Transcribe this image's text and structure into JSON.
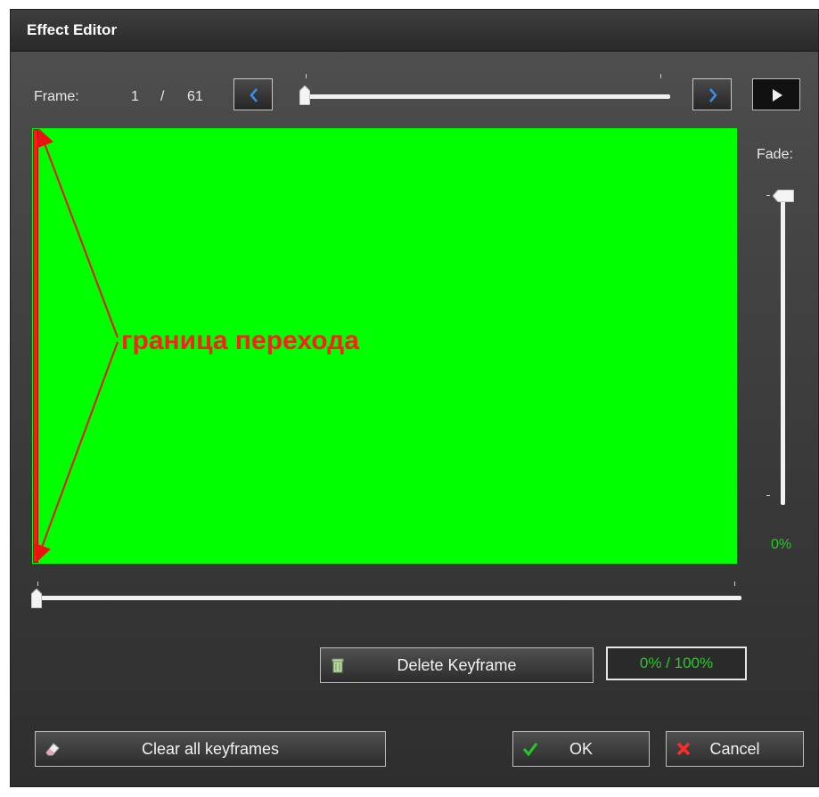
{
  "window": {
    "title": "Effect Editor"
  },
  "frame": {
    "label": "Frame:",
    "current": "1",
    "separator": "/",
    "total": "61",
    "prev_icon": "chevron-left-icon",
    "next_icon": "chevron-right-icon",
    "play_icon": "play-icon",
    "slider_position_fraction": 0.0
  },
  "preview": {
    "background_color": "#00ff00",
    "annotation_text": "граница перехода",
    "annotation_color": "#ff1e1e"
  },
  "timeline": {
    "position_fraction": 0.0
  },
  "fade": {
    "label": "Fade:",
    "value": "0%",
    "position_fraction": 1.0
  },
  "keyframe": {
    "delete_label": "Delete Keyframe",
    "delete_icon": "trash-icon",
    "percent_display": "0% / 100%"
  },
  "footer": {
    "clear_label": "Clear all keyframes",
    "clear_icon": "eraser-icon",
    "ok_label": "OK",
    "ok_icon": "checkmark-icon",
    "cancel_label": "Cancel",
    "cancel_icon": "x-icon"
  },
  "colors": {
    "accent_green": "#22cc22",
    "nav_arrow_blue": "#3a8ef0",
    "cancel_red": "#ff2a2a"
  }
}
